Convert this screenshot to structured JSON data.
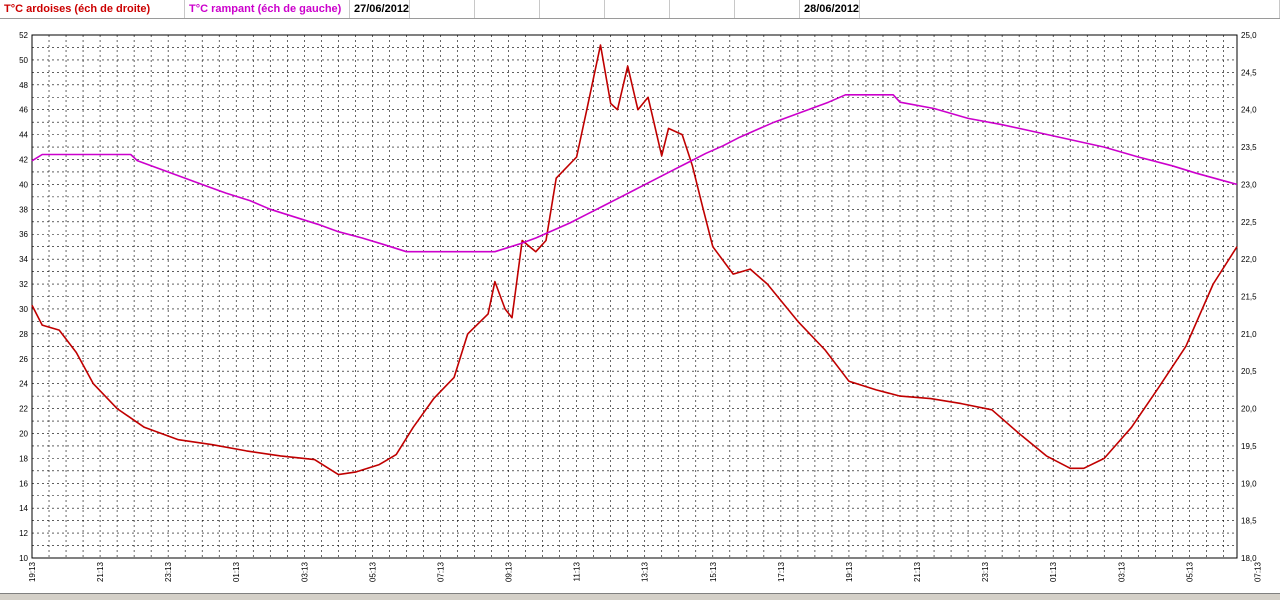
{
  "header": {
    "cells": [
      {
        "text": "T°C ardoises (éch de droite)",
        "color": "#cc0000"
      },
      {
        "text": "T°C rampant (éch de gauche)",
        "color": "#cc00cc"
      },
      {
        "text": "27/06/2012",
        "color": "#000000"
      },
      {
        "text": "",
        "color": "#000000"
      },
      {
        "text": "",
        "color": "#000000"
      },
      {
        "text": "",
        "color": "#000000"
      },
      {
        "text": "",
        "color": "#000000"
      },
      {
        "text": "",
        "color": "#000000"
      },
      {
        "text": "",
        "color": "#000000"
      },
      {
        "text": "28/06/2012",
        "color": "#000000"
      }
    ]
  },
  "colors": {
    "ardoises": "#c00000",
    "rampant": "#cc00cc",
    "grid": "#000000",
    "plot_bg": "#ffffff"
  },
  "chart_data": {
    "type": "line",
    "title": "",
    "grid": true,
    "legend": "none",
    "x_unit": "hour offset from 19:13 on 27/06/2012",
    "xlim": [
      0,
      35.4
    ],
    "x_tick_labels": [
      "19:13",
      "21:13",
      "23:13",
      "01:13",
      "03:13",
      "05:13",
      "07:13",
      "09:13",
      "11:13",
      "13:13",
      "15:13",
      "17:13",
      "19:13",
      "21:13",
      "23:13",
      "01:13",
      "03:13",
      "05:13",
      "07:13",
      "09:13",
      "11:13",
      "13:13",
      "15:13",
      "17:13",
      "19:13",
      "21:13",
      "23:13",
      "01:13",
      "03:13",
      "05:13"
    ],
    "left_axis": {
      "ylim": [
        10,
        52
      ],
      "ticks": [
        10,
        12,
        14,
        16,
        18,
        20,
        22,
        24,
        26,
        28,
        30,
        32,
        34,
        36,
        38,
        40,
        42,
        44,
        46,
        48,
        50,
        52
      ]
    },
    "right_axis": {
      "ylim": [
        18.0,
        25.0
      ],
      "ticks": [
        "18,0",
        "18,5",
        "19,0",
        "19,5",
        "20,0",
        "20,5",
        "21,0",
        "21,5",
        "22,0",
        "22,5",
        "23,0",
        "23,5",
        "24,0",
        "24,5",
        "25,0"
      ]
    },
    "series": [
      {
        "name": "T°C ardoises (éch de droite)",
        "color": "#c00000",
        "points": [
          [
            0,
            30.3
          ],
          [
            0.3,
            28.7
          ],
          [
            0.8,
            28.3
          ],
          [
            1.3,
            26.5
          ],
          [
            1.8,
            24.0
          ],
          [
            2.5,
            22.0
          ],
          [
            3.3,
            20.5
          ],
          [
            4.3,
            19.5
          ],
          [
            5.3,
            19.1
          ],
          [
            6.3,
            18.6
          ],
          [
            7.3,
            18.2
          ],
          [
            8.3,
            17.9
          ],
          [
            9.0,
            16.7
          ],
          [
            9.5,
            16.9
          ],
          [
            10.2,
            17.5
          ],
          [
            10.7,
            18.3
          ],
          [
            11.2,
            20.5
          ],
          [
            11.8,
            22.8
          ],
          [
            12.4,
            24.5
          ],
          [
            12.8,
            28.0
          ],
          [
            13.4,
            29.6
          ],
          [
            13.6,
            32.2
          ],
          [
            13.9,
            30.0
          ],
          [
            14.1,
            29.3
          ],
          [
            14.4,
            35.5
          ],
          [
            14.8,
            34.6
          ],
          [
            15.1,
            35.5
          ],
          [
            15.4,
            40.5
          ],
          [
            16.0,
            42.2
          ],
          [
            16.3,
            46.0
          ],
          [
            16.7,
            51.2
          ],
          [
            17.0,
            46.5
          ],
          [
            17.2,
            46.0
          ],
          [
            17.5,
            49.5
          ],
          [
            17.8,
            46.0
          ],
          [
            18.1,
            47.0
          ],
          [
            18.5,
            42.3
          ],
          [
            18.7,
            44.5
          ],
          [
            19.1,
            44.0
          ],
          [
            19.4,
            41.5
          ],
          [
            19.7,
            38.2
          ],
          [
            20.0,
            35.0
          ],
          [
            20.6,
            32.8
          ],
          [
            21.1,
            33.2
          ],
          [
            21.6,
            32.0
          ],
          [
            22.5,
            29.0
          ],
          [
            23.3,
            26.7
          ],
          [
            24.0,
            24.2
          ],
          [
            24.8,
            23.5
          ],
          [
            25.5,
            23.0
          ],
          [
            26.4,
            22.8
          ],
          [
            27.3,
            22.4
          ],
          [
            28.2,
            21.9
          ],
          [
            29.0,
            20.0
          ],
          [
            29.8,
            18.2
          ],
          [
            30.5,
            17.2
          ],
          [
            30.9,
            17.2
          ],
          [
            31.5,
            18.0
          ],
          [
            32.3,
            20.5
          ],
          [
            33.1,
            23.7
          ],
          [
            33.9,
            27.0
          ],
          [
            34.7,
            32.0
          ],
          [
            35.4,
            35.0
          ]
        ]
      },
      {
        "name": "T°C rampant (éch de gauche)",
        "color": "#cc00cc",
        "points": [
          [
            0,
            41.9
          ],
          [
            0.3,
            42.4
          ],
          [
            2.9,
            42.4
          ],
          [
            3.1,
            41.9
          ],
          [
            3.8,
            41.2
          ],
          [
            4.4,
            40.6
          ],
          [
            5.1,
            39.9
          ],
          [
            5.7,
            39.3
          ],
          [
            6.4,
            38.7
          ],
          [
            7.0,
            38.0
          ],
          [
            7.7,
            37.4
          ],
          [
            8.4,
            36.8
          ],
          [
            9.0,
            36.2
          ],
          [
            9.7,
            35.7
          ],
          [
            10.3,
            35.2
          ],
          [
            11.0,
            34.6
          ],
          [
            13.6,
            34.6
          ],
          [
            14.3,
            35.2
          ],
          [
            14.8,
            35.7
          ],
          [
            15.3,
            36.3
          ],
          [
            15.8,
            36.9
          ],
          [
            16.3,
            37.6
          ],
          [
            16.8,
            38.3
          ],
          [
            17.3,
            39.0
          ],
          [
            17.8,
            39.7
          ],
          [
            18.3,
            40.4
          ],
          [
            18.8,
            41.1
          ],
          [
            19.3,
            41.8
          ],
          [
            19.8,
            42.5
          ],
          [
            20.3,
            43.1
          ],
          [
            20.8,
            43.8
          ],
          [
            21.3,
            44.4
          ],
          [
            21.8,
            45.0
          ],
          [
            22.4,
            45.6
          ],
          [
            22.9,
            46.1
          ],
          [
            23.4,
            46.6
          ],
          [
            23.9,
            47.2
          ],
          [
            25.3,
            47.2
          ],
          [
            25.5,
            46.6
          ],
          [
            26.5,
            46.1
          ],
          [
            27.5,
            45.3
          ],
          [
            28.5,
            44.8
          ],
          [
            29.5,
            44.2
          ],
          [
            30.5,
            43.6
          ],
          [
            31.5,
            43.0
          ],
          [
            32.5,
            42.2
          ],
          [
            33.5,
            41.5
          ],
          [
            34.2,
            40.9
          ],
          [
            35.0,
            40.3
          ],
          [
            35.4,
            40.0
          ]
        ]
      }
    ]
  }
}
